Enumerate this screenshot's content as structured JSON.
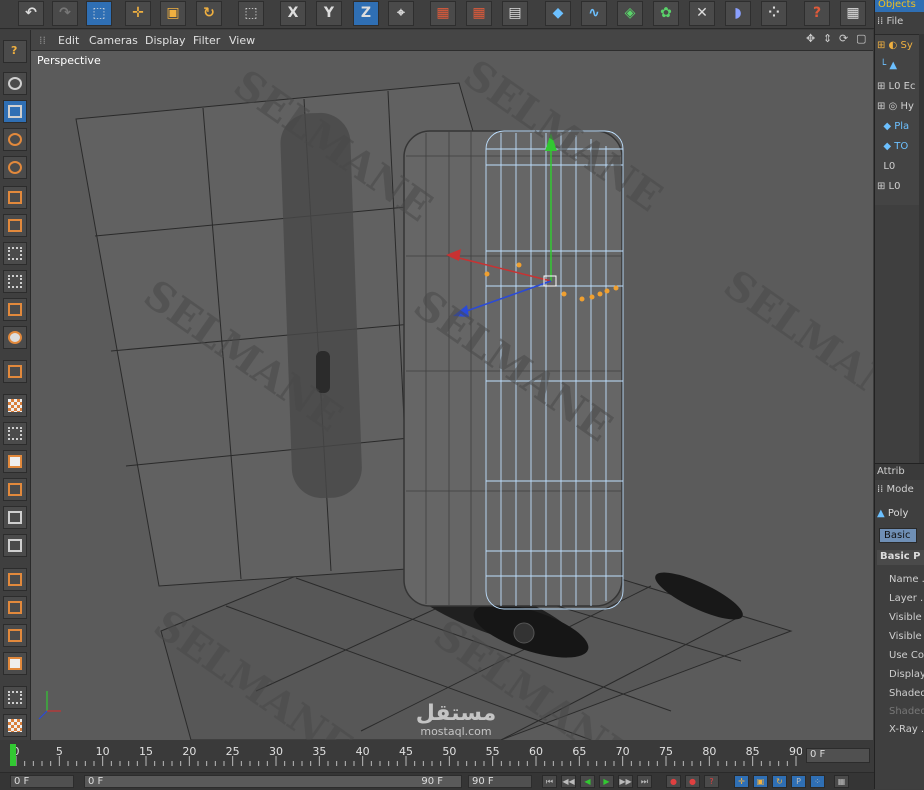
{
  "toolbar": {
    "axis_x": "X",
    "axis_y": "Y",
    "axis_z": "Z"
  },
  "viewport_menu": {
    "items": [
      "Edit",
      "Cameras",
      "Display",
      "Filter",
      "View"
    ]
  },
  "viewport": {
    "title": "Perspective",
    "watermark": "SELMANE"
  },
  "object_manager": {
    "tab": "Objects",
    "menu_file": "File",
    "items": [
      "Sy",
      "",
      "Ec",
      "Hy",
      "Pla",
      "TO",
      "",
      ""
    ]
  },
  "attribute_manager": {
    "tab": "Attrib",
    "mode": "Mode",
    "object_type": "Poly",
    "tab_basic": "Basic",
    "section": "Basic P",
    "fields": [
      "Name .",
      "Layer .",
      "Visible i",
      "Visible i",
      "Use Co",
      "Display",
      "Shaded",
      "Shaded",
      "X-Ray ."
    ]
  },
  "timeline": {
    "ticks": [
      "0",
      "5",
      "10",
      "15",
      "20",
      "25",
      "30",
      "35",
      "40",
      "45",
      "50",
      "55",
      "60",
      "65",
      "70",
      "75",
      "80",
      "85",
      "90"
    ],
    "current_frame_display": "0 F",
    "start_frame": "0 F",
    "range_start": "0 F",
    "range_end": "90 F",
    "end_frame": "90 F"
  },
  "branding": {
    "logo_arabic": "مستقل",
    "logo_latin": "mostaql.com"
  },
  "colors": {
    "accent_blue": "#2f6fb4",
    "selection_orange": "#f0a030",
    "axis_red": "#c83232",
    "axis_green": "#32c832",
    "axis_blue": "#2a4ad8",
    "wire_blue": "#bfe0ff"
  }
}
